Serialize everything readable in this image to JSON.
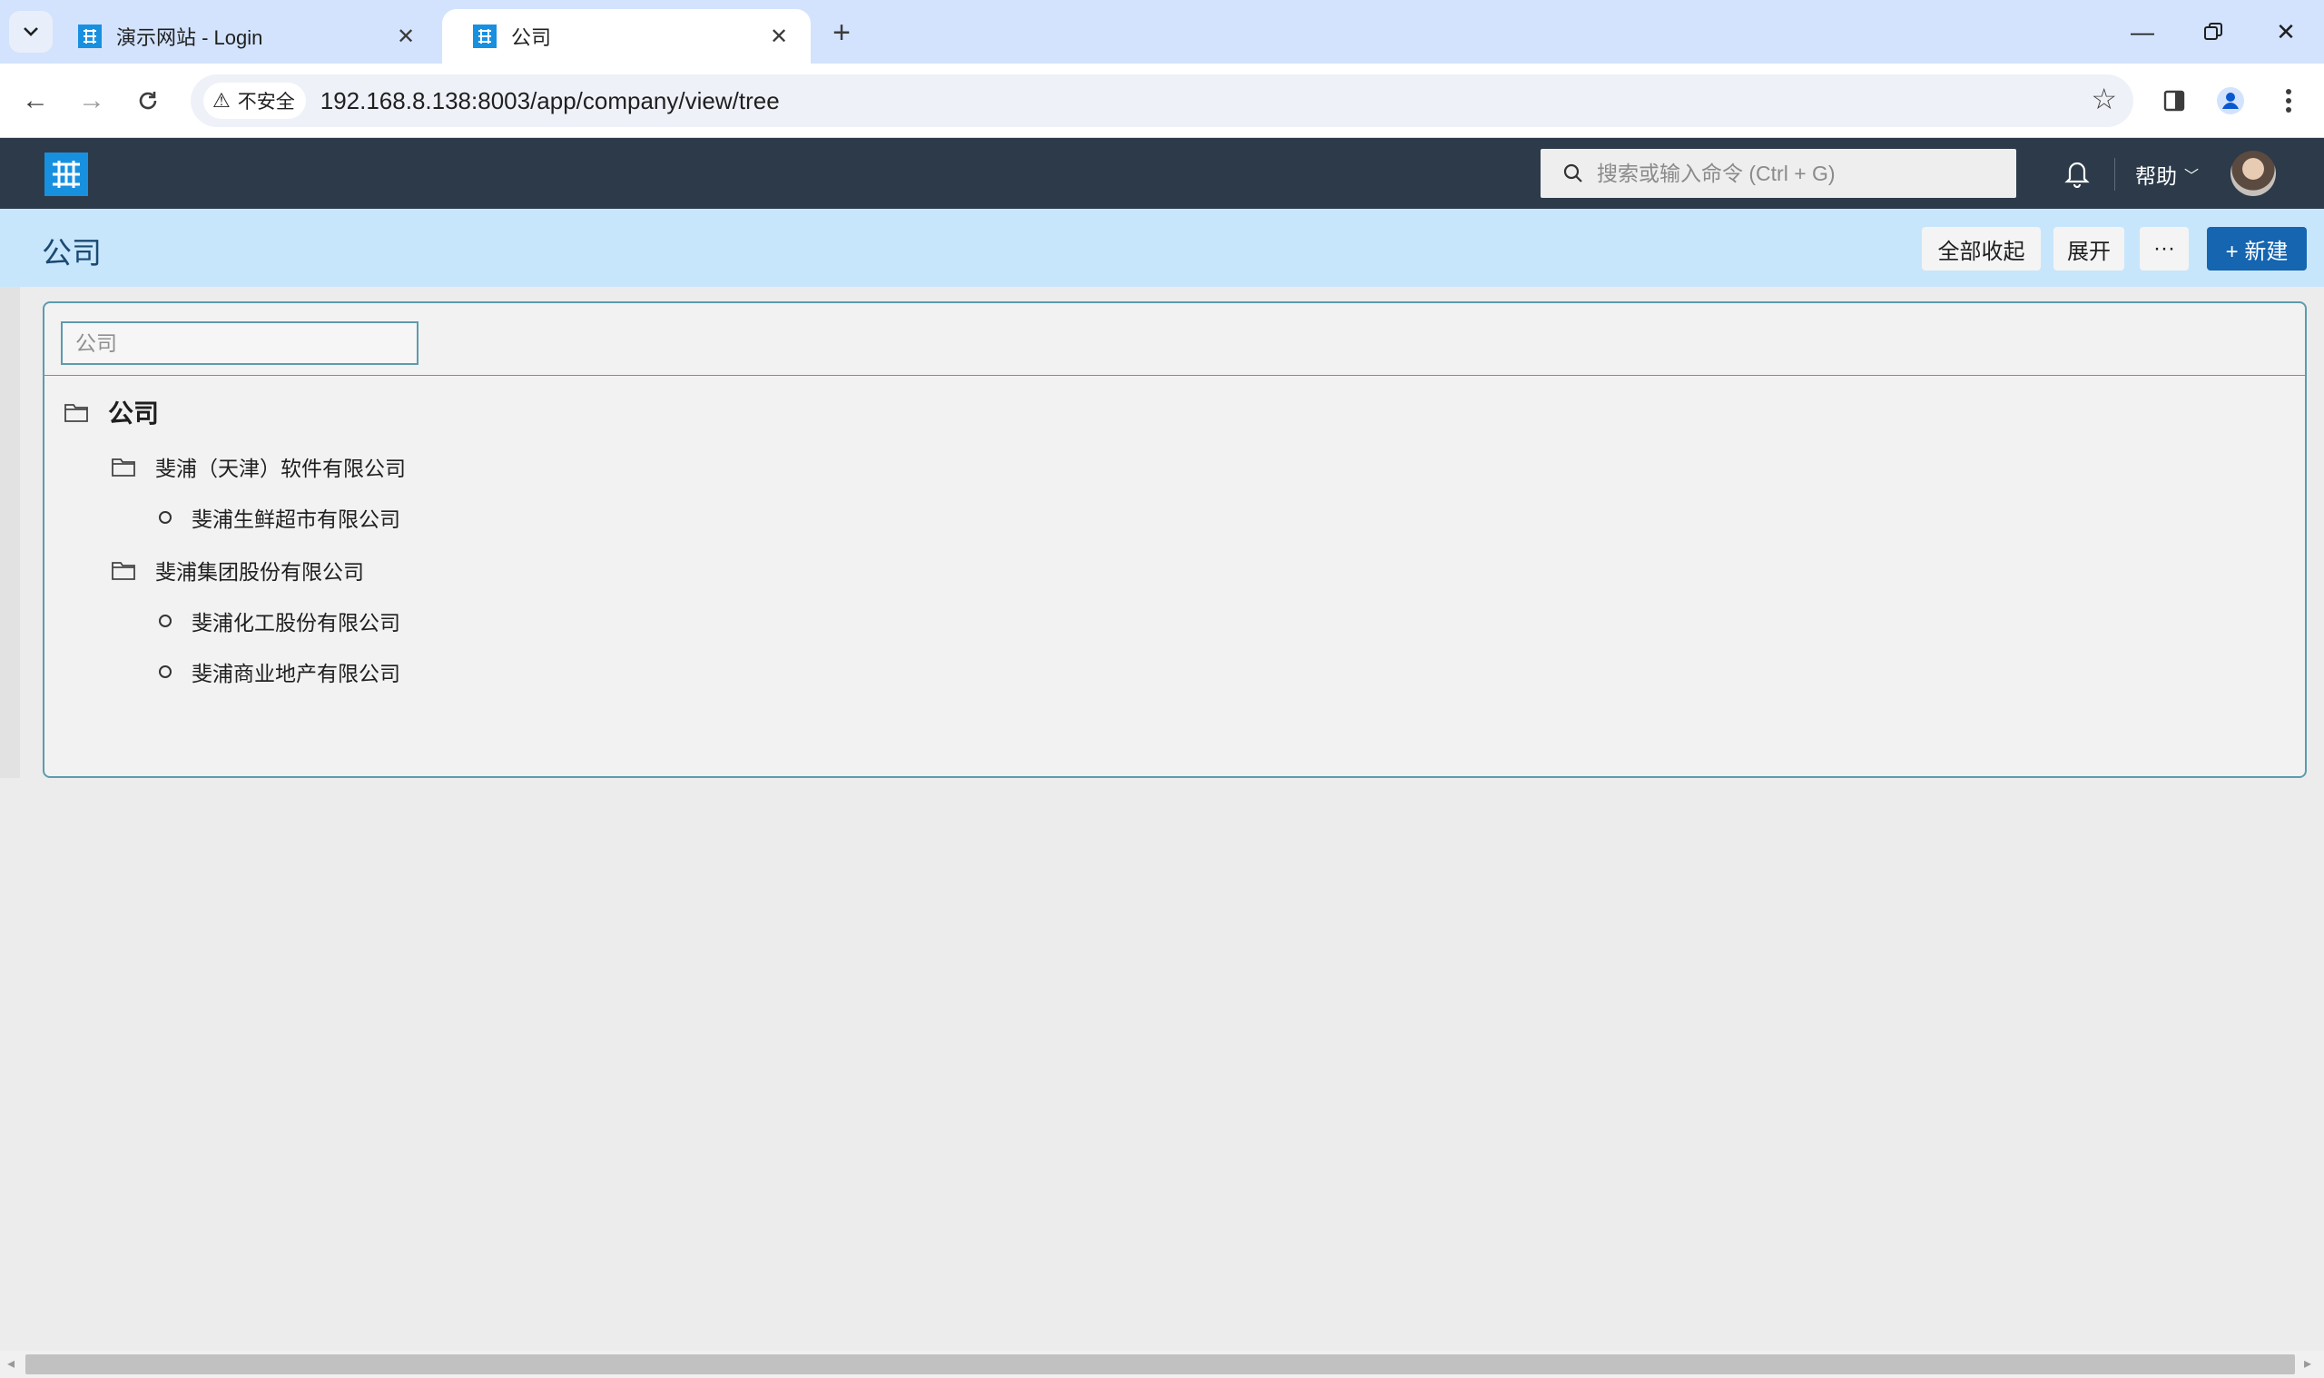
{
  "browser": {
    "tabs": [
      {
        "title": "演示网站 - Login",
        "active": false
      },
      {
        "title": "公司",
        "active": true
      }
    ],
    "security_label": "不安全",
    "url": "192.168.8.138:8003/app/company/view/tree"
  },
  "header": {
    "search_placeholder": "搜索或输入命令 (Ctrl + G)",
    "help_label": "帮助"
  },
  "page": {
    "title": "公司",
    "buttons": {
      "collapse_all": "全部收起",
      "expand": "展开",
      "more": "···",
      "new": "+ 新建"
    }
  },
  "tree": {
    "filter_placeholder": "公司",
    "root": "公司",
    "nodes": [
      {
        "label": "斐浦（天津）软件有限公司",
        "type": "folder"
      },
      {
        "label": "斐浦生鲜超市有限公司",
        "type": "leaf"
      },
      {
        "label": "斐浦集团股份有限公司",
        "type": "folder"
      },
      {
        "label": "斐浦化工股份有限公司",
        "type": "leaf"
      },
      {
        "label": "斐浦商业地产有限公司",
        "type": "leaf"
      }
    ]
  },
  "colors": {
    "accent": "#1565b0",
    "header_bg": "#2c3a4a",
    "page_head_bg": "#c8e6fb",
    "panel_border": "#5b9cae"
  }
}
